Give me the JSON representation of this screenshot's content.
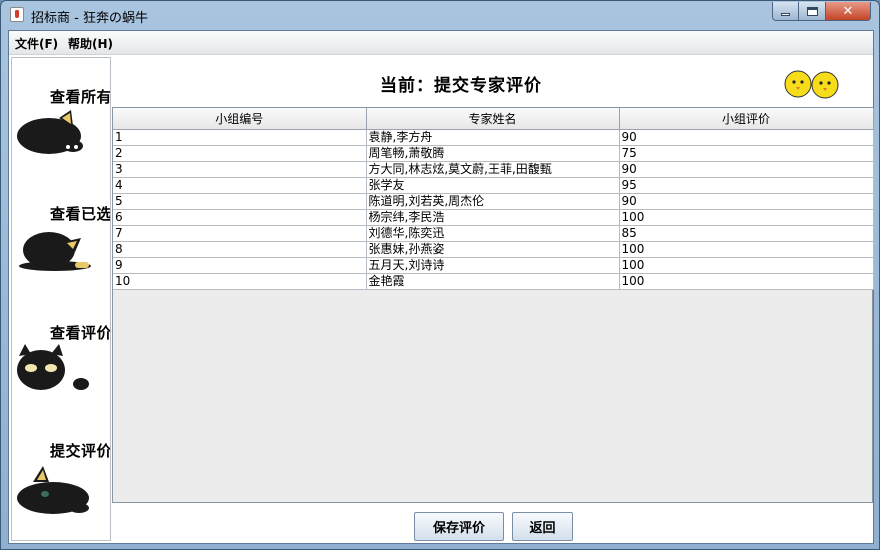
{
  "window": {
    "title": "招标商 - 狂奔の蜗牛"
  },
  "menu": {
    "file": "文件(F)",
    "help": "帮助(H)"
  },
  "sidebar": {
    "items": [
      {
        "label": "查看所有"
      },
      {
        "label": "查看已选"
      },
      {
        "label": "查看评价"
      },
      {
        "label": "提交评价"
      }
    ]
  },
  "heading": "当前：提交专家评价",
  "table": {
    "columns": [
      "小组编号",
      "专家姓名",
      "小组评价"
    ],
    "rows": [
      [
        "1",
        "袁静,李方舟",
        "90"
      ],
      [
        "2",
        "周笔畅,萧敬腾",
        "75"
      ],
      [
        "3",
        "方大同,林志炫,莫文蔚,王菲,田馥甄",
        "90"
      ],
      [
        "4",
        "张学友",
        "95"
      ],
      [
        "5",
        "陈道明,刘若英,周杰伦",
        "90"
      ],
      [
        "6",
        "杨宗纬,李民浩",
        "100"
      ],
      [
        "7",
        "刘德华,陈奕迅",
        "85"
      ],
      [
        "8",
        "张惠妹,孙燕姿",
        "100"
      ],
      [
        "9",
        "五月天,刘诗诗",
        "100"
      ],
      [
        "10",
        "金艳霞",
        "100"
      ]
    ]
  },
  "buttons": {
    "save": "保存评价",
    "back": "返回"
  },
  "icons": {
    "app": "java-cup-icon",
    "sidebar": "black-cat-icon",
    "decor": "yellow-chicks-icon"
  },
  "colors": {
    "accent": "#a9c4df",
    "close": "#c34528"
  }
}
